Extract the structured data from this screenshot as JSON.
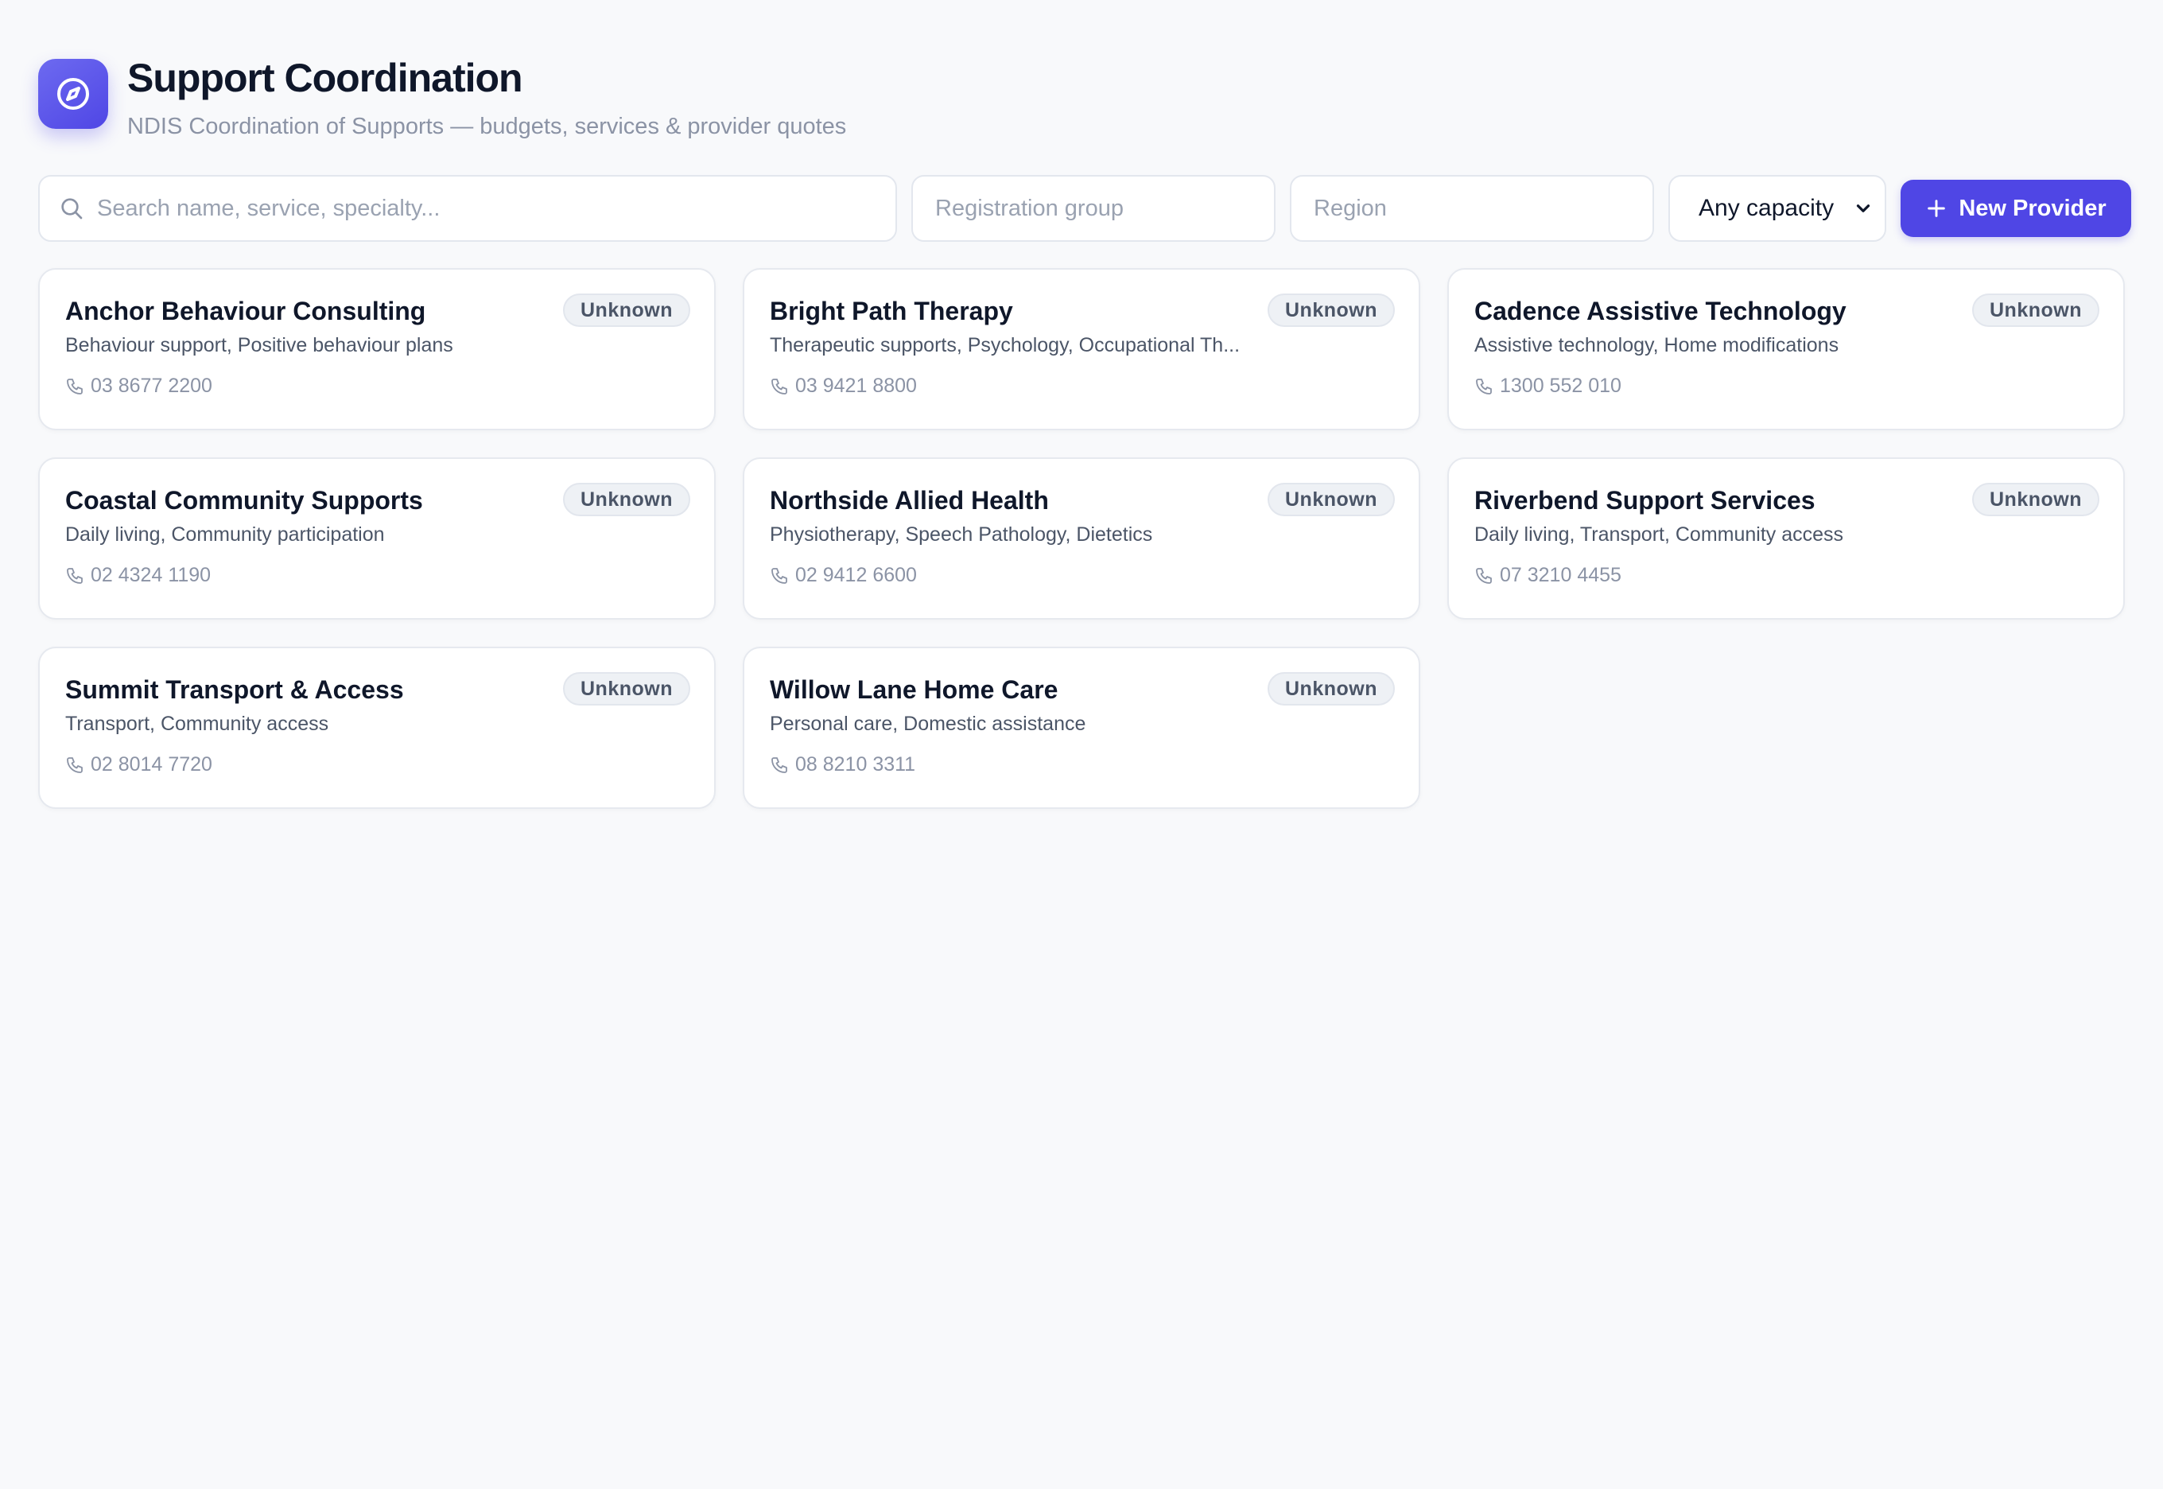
{
  "header": {
    "title": "Support Coordination",
    "subtitle": "NDIS Coordination of Supports — budgets, services & provider quotes",
    "app_icon": "compass-icon"
  },
  "toolbar": {
    "search_placeholder": "Search name, service, specialty...",
    "registration_placeholder": "Registration group",
    "region_placeholder": "Region",
    "capacity_selected": "Any capacity",
    "new_button_label": "New Provider"
  },
  "colors": {
    "accent": "#4f46e5",
    "background": "#f8f9fb",
    "badge_bg": "#eef1f5"
  },
  "providers": [
    {
      "name": "Anchor Behaviour Consulting",
      "services": "Behaviour support, Positive behaviour plans",
      "phone": "03 8677 2200",
      "status": "Unknown"
    },
    {
      "name": "Bright Path Therapy",
      "services": "Therapeutic supports, Psychology, Occupational Th...",
      "phone": "03 9421 8800",
      "status": "Unknown"
    },
    {
      "name": "Cadence Assistive Technology",
      "services": "Assistive technology, Home modifications",
      "phone": "1300 552 010",
      "status": "Unknown"
    },
    {
      "name": "Coastal Community Supports",
      "services": "Daily living, Community participation",
      "phone": "02 4324 1190",
      "status": "Unknown"
    },
    {
      "name": "Northside Allied Health",
      "services": "Physiotherapy, Speech Pathology, Dietetics",
      "phone": "02 9412 6600",
      "status": "Unknown"
    },
    {
      "name": "Riverbend Support Services",
      "services": "Daily living, Transport, Community access",
      "phone": "07 3210 4455",
      "status": "Unknown"
    },
    {
      "name": "Summit Transport & Access",
      "services": "Transport, Community access",
      "phone": "02 8014 7720",
      "status": "Unknown"
    },
    {
      "name": "Willow Lane Home Care",
      "services": "Personal care, Domestic assistance",
      "phone": "08 8210 3311",
      "status": "Unknown"
    }
  ]
}
